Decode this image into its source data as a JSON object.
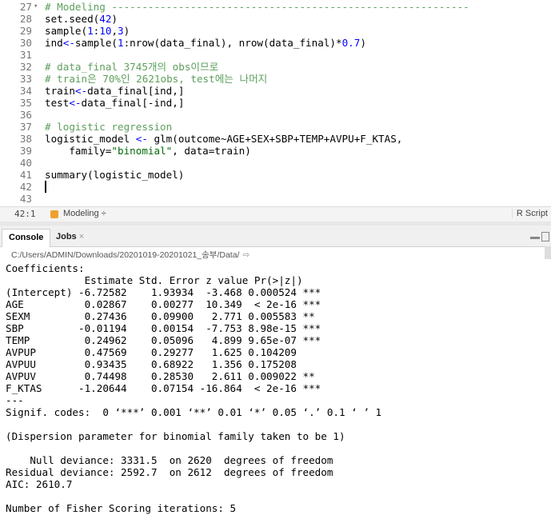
{
  "editor": {
    "lines": [
      {
        "n": "27",
        "fold": "▾",
        "parts": [
          {
            "t": "# Modeling -----------------------------------------------------------",
            "c": "cm"
          }
        ]
      },
      {
        "n": "28",
        "parts": [
          {
            "t": "set.seed(",
            "c": "fn"
          },
          {
            "t": "42",
            "c": "num"
          },
          {
            "t": ")",
            "c": "fn"
          }
        ]
      },
      {
        "n": "29",
        "parts": [
          {
            "t": "sample(",
            "c": "fn"
          },
          {
            "t": "1",
            "c": "num"
          },
          {
            "t": ":",
            "c": "fn"
          },
          {
            "t": "10",
            "c": "num"
          },
          {
            "t": ",",
            "c": "fn"
          },
          {
            "t": "3",
            "c": "num"
          },
          {
            "t": ")",
            "c": "fn"
          }
        ]
      },
      {
        "n": "30",
        "parts": [
          {
            "t": "ind",
            "c": "fn"
          },
          {
            "t": "<-",
            "c": "kw"
          },
          {
            "t": "sample(",
            "c": "fn"
          },
          {
            "t": "1",
            "c": "num"
          },
          {
            "t": ":nrow(data_final), nrow(data_final)*",
            "c": "fn"
          },
          {
            "t": "0.7",
            "c": "num"
          },
          {
            "t": ")",
            "c": "fn"
          }
        ]
      },
      {
        "n": "31",
        "parts": []
      },
      {
        "n": "32",
        "parts": [
          {
            "t": "# data_final 3745개의 obs이므로",
            "c": "cm"
          }
        ]
      },
      {
        "n": "33",
        "parts": [
          {
            "t": "# train은 70%인 2621obs, test에는 나머지",
            "c": "cm"
          }
        ]
      },
      {
        "n": "34",
        "parts": [
          {
            "t": "train",
            "c": "fn"
          },
          {
            "t": "<-",
            "c": "kw"
          },
          {
            "t": "data_final[ind,]",
            "c": "fn"
          }
        ]
      },
      {
        "n": "35",
        "parts": [
          {
            "t": "test",
            "c": "fn"
          },
          {
            "t": "<-",
            "c": "kw"
          },
          {
            "t": "data_final[-ind,]",
            "c": "fn"
          }
        ]
      },
      {
        "n": "36",
        "parts": []
      },
      {
        "n": "37",
        "parts": [
          {
            "t": "# logistic regression",
            "c": "cm"
          }
        ]
      },
      {
        "n": "38",
        "parts": [
          {
            "t": "logistic_model ",
            "c": "fn"
          },
          {
            "t": "<-",
            "c": "kw"
          },
          {
            "t": " glm(outcome~AGE+SEX+SBP+TEMP+AVPU+F_KTAS,",
            "c": "fn"
          }
        ]
      },
      {
        "n": "39",
        "parts": [
          {
            "t": "    family=",
            "c": "fn"
          },
          {
            "t": "\"binomial\"",
            "c": "str"
          },
          {
            "t": ", data=train)",
            "c": "fn"
          }
        ]
      },
      {
        "n": "40",
        "parts": []
      },
      {
        "n": "41",
        "parts": [
          {
            "t": "summary(logistic_model)",
            "c": "fn"
          }
        ]
      },
      {
        "n": "42",
        "parts": []
      },
      {
        "n": "43",
        "parts": []
      }
    ]
  },
  "statusbar": {
    "position": "42:1",
    "section": "Modeling ÷",
    "filetype": "R Script"
  },
  "tabs": {
    "console": "Console",
    "jobs": "Jobs",
    "jobs_close": "×"
  },
  "path": "C:/Users/ADMIN/Downloads/20201019-20201021_송부/Data/",
  "path_icon": "⇨",
  "console": {
    "lines": [
      "Coefficients:",
      "             Estimate Std. Error z value Pr(>|z|)    ",
      "(Intercept) -6.72582    1.93934  -3.468 0.000524 ***",
      "AGE          0.02867    0.00277  10.349  < 2e-16 ***",
      "SEXM         0.27436    0.09900   2.771 0.005583 ** ",
      "SBP         -0.01194    0.00154  -7.753 8.98e-15 ***",
      "TEMP         0.24962    0.05096   4.899 9.65e-07 ***",
      "AVPUP        0.47569    0.29277   1.625 0.104209    ",
      "AVPUU        0.93435    0.68922   1.356 0.175208    ",
      "AVPUV        0.74498    0.28530   2.611 0.009022 ** ",
      "F_KTAS      -1.20644    0.07154 -16.864  < 2e-16 ***",
      "---",
      "Signif. codes:  0 ‘***’ 0.001 ‘**’ 0.01 ‘*’ 0.05 ‘.’ 0.1 ‘ ’ 1",
      "",
      "(Dispersion parameter for binomial family taken to be 1)",
      "",
      "    Null deviance: 3331.5  on 2620  degrees of freedom",
      "Residual deviance: 2592.7  on 2612  degrees of freedom",
      "AIC: 2610.7",
      "",
      "Number of Fisher Scoring iterations: 5"
    ]
  }
}
